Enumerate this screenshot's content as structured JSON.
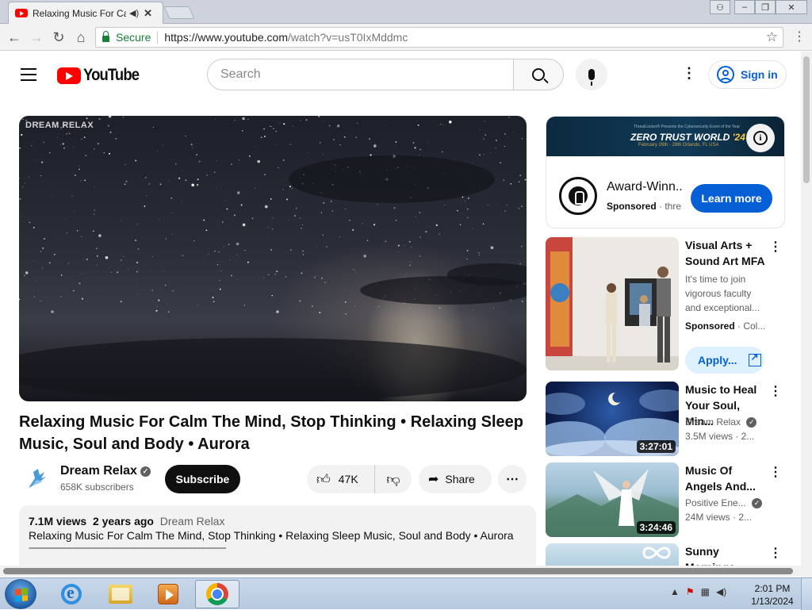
{
  "browser": {
    "tab_title": "Relaxing Music For Calm",
    "secure_label": "Secure",
    "url_host": "https://www.youtube.com",
    "url_path": "/watch?v=usT0IxMddmc"
  },
  "header": {
    "logo_text": "YouTube",
    "search_placeholder": "Search",
    "signin_label": "Sign in"
  },
  "video": {
    "watermark": "DREAM RELAX",
    "title": "Relaxing Music For Calm The Mind, Stop Thinking • Relaxing Sleep Music, Soul and Body • Aurora",
    "channel_name": "Dream Relax",
    "subscribers": "658K subscribers",
    "subscribe_label": "Subscribe",
    "likes": "47K",
    "share_label": "Share"
  },
  "description": {
    "views": "7.1M views",
    "age": "2 years ago",
    "tag": "Dream Relax",
    "text": "Relaxing Music For Calm The Mind, Stop Thinking • Relaxing Sleep Music, Soul and Body • Aurora",
    "divider": "-----------------------------------------------------------------------------------"
  },
  "ad": {
    "banner_top": "ThreatLocker® Presents the Cybersecurity Event of the Year",
    "banner_title_1": "ZERO TRUST WORLD",
    "banner_title_2": "'24",
    "banner_sub": "February 26th - 28th Orlando, FL USA",
    "title": "Award-Winn..",
    "sponsored": "Sponsored",
    "advertiser": "· thre",
    "cta": "Learn more"
  },
  "recommendations": [
    {
      "title": "Visual Arts + Sound Art MFA",
      "desc": [
        "It's time to join",
        "vigorous faculty",
        "and exceptional..."
      ],
      "sponsored": "Sponsored",
      "advertiser": "· Col...",
      "cta": "Apply..."
    },
    {
      "title": "Music to Heal Your Soul, Min...",
      "channel": "Dream Relax",
      "meta": "3.5M views · 2...",
      "duration": "3:27:01"
    },
    {
      "title": "Music Of Angels And...",
      "channel": "Positive Ene...",
      "meta": "24M views · 2...",
      "duration": "3:24:46"
    },
    {
      "title": "Sunny Mornings:",
      "channel": "",
      "meta": "",
      "duration": ""
    }
  ],
  "taskbar": {
    "time": "2:01 PM",
    "date": "1/13/2024"
  },
  "colors": {
    "youtube_red": "#ff0000",
    "link_blue": "#065fd4",
    "secure_green": "#188038"
  },
  "icons": [
    "back-icon",
    "forward-icon",
    "reload-icon",
    "home-icon",
    "lock-icon",
    "star-icon",
    "menu-icon",
    "search-icon",
    "mic-icon",
    "user-icon",
    "like-icon",
    "dislike-icon",
    "share-icon",
    "info-icon",
    "external-link-icon"
  ]
}
